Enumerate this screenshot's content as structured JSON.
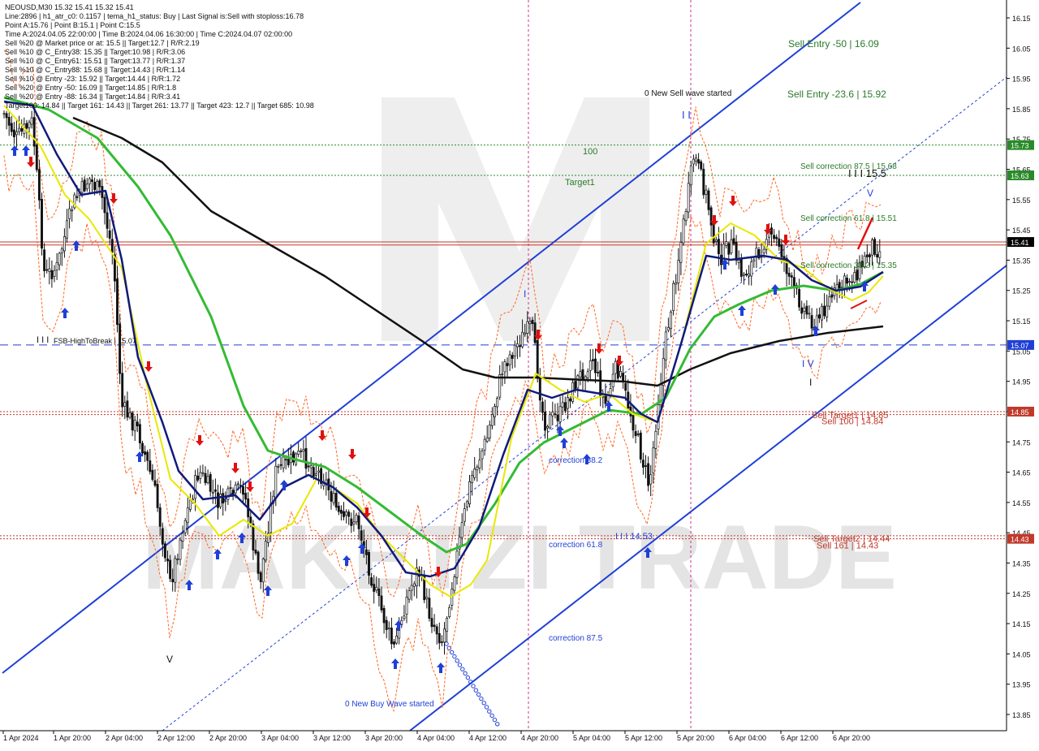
{
  "chart_data": {
    "type": "candlestick",
    "symbol": "NEOUSD",
    "timeframe": "M30",
    "quote": "15.32 15.41 15.32 15.41",
    "watermark": "MAKETZI TRADE",
    "info_lines": [
      "NEOUSD,M30  15.32 15.41 15.32 15.41",
      "Line:2896 | h1_atr_c0: 0.1157 | tema_h1_status: Buy | Last Signal is:Sell with stoploss:16.78",
      "Point A:15.76 | Point B:15.1 | Point C:15.5",
      "Time A:2024.04.05 22:00:00 | Time B:2024.04.06 16:30:00 | Time C:2024.04.07 02:00:00",
      "Sell %20 @ Market price or at: 15.5 || Target:12.7 | R/R:2.19",
      "Sell %10 @ C_Entry38: 15.35 || Target:10.98 | R/R:3.06",
      "Sell %10 @ C_Entry61: 15.51 || Target:13.77 | R/R:1.37",
      "Sell %10 @ C_Entry88: 15.68 || Target:14.43 | R/R:1.14",
      "Sell %10 @ Entry -23: 15.92 || Target:14.44 | R/R:1.72",
      "Sell %20 @ Entry -50: 16.09 || Target:14.85 | R/R:1.8",
      "Sell %20 @ Entry -88: 16.34 || Target:14.84 | R/R:3.41",
      "Target100: 14.84 || Target 161: 14.43 || Target 261: 13.77 || Target 423: 12.7 || Target 685: 10.98"
    ],
    "y_axis": {
      "range": [
        13.8,
        16.2
      ],
      "ticks": [
        "16.15",
        "16.05",
        "15.95",
        "15.85",
        "15.75",
        "15.65",
        "15.55",
        "15.45",
        "15.35",
        "15.25",
        "15.15",
        "15.05",
        "14.95",
        "14.85",
        "14.75",
        "14.65",
        "14.55",
        "14.45",
        "14.35",
        "14.25",
        "14.15",
        "14.05",
        "13.95",
        "13.85"
      ]
    },
    "x_axis": {
      "labels": [
        "1 Apr 2024",
        "1 Apr 20:00",
        "2 Apr 04:00",
        "2 Apr 12:00",
        "2 Apr 20:00",
        "3 Apr 04:00",
        "3 Apr 12:00",
        "3 Apr 20:00",
        "4 Apr 04:00",
        "4 Apr 12:00",
        "4 Apr 20:00",
        "5 Apr 04:00",
        "5 Apr 12:00",
        "5 Apr 20:00",
        "6 Apr 04:00",
        "6 Apr 12:00",
        "6 Apr 20:00"
      ]
    },
    "price_tags": [
      {
        "value": 15.73,
        "label": "15.73",
        "color": "#2a8a2a"
      },
      {
        "value": 15.63,
        "label": "15.63",
        "color": "#2a8a2a"
      },
      {
        "value": 15.41,
        "label": "15.41",
        "color": "#000000"
      },
      {
        "value": 15.07,
        "label": "15.07",
        "color": "#1f3fd6"
      },
      {
        "value": 14.85,
        "label": "14.85",
        "color": "#c0392b"
      },
      {
        "value": 14.43,
        "label": "14.43",
        "color": "#c0392b"
      }
    ],
    "horizontal_levels": [
      {
        "value": 15.73,
        "color": "#2a8a2a",
        "style": "dotted",
        "label": "100"
      },
      {
        "value": 15.63,
        "color": "#2a8a2a",
        "style": "dotted",
        "label": "Target1"
      },
      {
        "value": 15.41,
        "color": "#c0392b",
        "style": "solid",
        "label": ""
      },
      {
        "value": 15.4,
        "color": "#c0392b",
        "style": "solid",
        "label": ""
      },
      {
        "value": 15.07,
        "color": "#1f3fd6",
        "style": "dashed",
        "label": "FSB-HighToBreak | 15.07"
      },
      {
        "value": 14.85,
        "color": "#c0392b",
        "style": "dotted",
        "label": "Sell Target1 | 14.85"
      },
      {
        "value": 14.84,
        "color": "#c0392b",
        "style": "dotted",
        "label": "Sell 100 | 14.84"
      },
      {
        "value": 14.44,
        "color": "#c0392b",
        "style": "dotted",
        "label": "Sell Target2 | 14.44"
      },
      {
        "value": 14.43,
        "color": "#c0392b",
        "style": "dotted",
        "label": "Sell 161 | 14.43"
      }
    ],
    "annotations": [
      {
        "text": "Sell Entry -50 | 16.09",
        "color": "#2a7a2a",
        "size": 12
      },
      {
        "text": "Sell Entry -23.6 | 15.92",
        "color": "#2a7a2a",
        "size": 12
      },
      {
        "text": "0 New Sell wave started",
        "color": "#111111",
        "size": 10
      },
      {
        "text": "I I",
        "color": "#1f3fd6",
        "size": 13
      },
      {
        "text": "100",
        "color": "#2a7a2a",
        "size": 11
      },
      {
        "text": "Target1",
        "color": "#2a7a2a",
        "size": 11
      },
      {
        "text": "Sell correction 87.5 | 15.68",
        "color": "#2a7a2a",
        "size": 10
      },
      {
        "text": "I I I 15.5",
        "color": "#111111",
        "size": 13
      },
      {
        "text": "V",
        "color": "#1f3fd6",
        "size": 12
      },
      {
        "text": "Sell correction 61.8 | 15.51",
        "color": "#2a7a2a",
        "size": 10
      },
      {
        "text": "Sell correction 38.2 | 15.35",
        "color": "#2a7a2a",
        "size": 10
      },
      {
        "text": "I V",
        "color": "#1f3fd6",
        "size": 12
      },
      {
        "text": "I",
        "color": "#111111",
        "size": 12
      },
      {
        "text": "I",
        "color": "#1f3fd6",
        "size": 12
      },
      {
        "text": "correction 38.2",
        "color": "#1f3fd6",
        "size": 10
      },
      {
        "text": "correction 61.8",
        "color": "#1f3fd6",
        "size": 10
      },
      {
        "text": "I I I 14.53",
        "color": "#1f3fd6",
        "size": 11
      },
      {
        "text": "correction 87.5",
        "color": "#1f3fd6",
        "size": 10
      },
      {
        "text": "0 New Buy Wave started",
        "color": "#1f3fd6",
        "size": 10
      },
      {
        "text": "V",
        "color": "#111111",
        "size": 12
      },
      {
        "text": "I I I",
        "color": "#111111",
        "size": 11
      }
    ],
    "colors": {
      "candle": "#111111",
      "ema_black": "#111111",
      "ema_green": "#33bb33",
      "ema_navy": "#101a7a",
      "ema_yellow": "#e8e800",
      "channel": "#1f3fd6",
      "bands": "#ff6622",
      "sell_arrow": "#e01010",
      "buy_arrow": "#1f3fd6",
      "axis_text": "#111111",
      "watermark": "#d9d9d9"
    }
  }
}
